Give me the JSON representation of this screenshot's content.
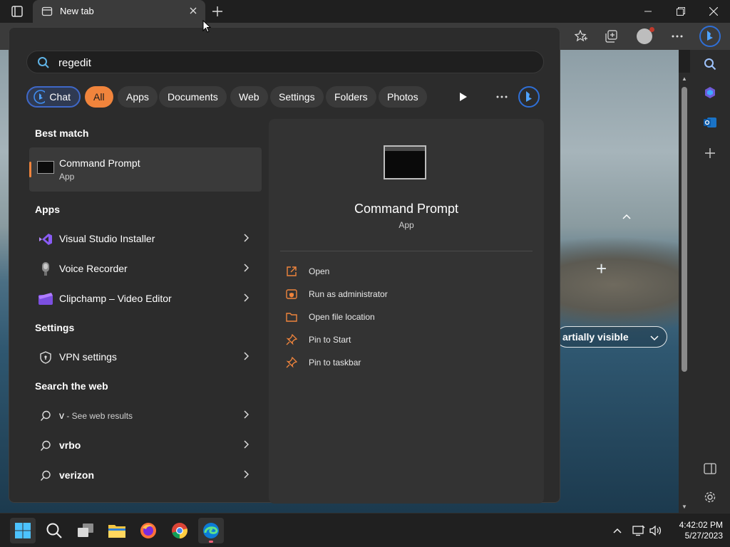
{
  "browser": {
    "tab_title": "New tab",
    "visibility_text": "artially visible"
  },
  "search": {
    "query": "regedit",
    "filters": [
      "Chat",
      "All",
      "Apps",
      "Documents",
      "Web",
      "Settings",
      "Folders",
      "Photos"
    ],
    "active_filter": "All"
  },
  "results": {
    "best_match_title": "Best match",
    "best_match": {
      "name": "Command Prompt",
      "type": "App"
    },
    "apps_title": "Apps",
    "apps": [
      "Visual Studio Installer",
      "Voice Recorder",
      "Clipchamp – Video Editor"
    ],
    "settings_title": "Settings",
    "settings": [
      "VPN settings"
    ],
    "web_title": "Search the web",
    "web": [
      {
        "query": "v",
        "suffix": " - See web results"
      },
      {
        "query": "vrbo",
        "suffix": ""
      },
      {
        "query": "verizon",
        "suffix": ""
      }
    ]
  },
  "preview": {
    "name": "Command Prompt",
    "type": "App",
    "actions": [
      "Open",
      "Run as administrator",
      "Open file location",
      "Pin to Start",
      "Pin to taskbar"
    ]
  },
  "taskbar": {
    "time": "4:42:02 PM",
    "date": "5/27/2023"
  },
  "colors": {
    "accent": "#f0843c",
    "chat_border": "#3f68c8",
    "panel": "#2c2c2c"
  },
  "icons": [
    "tab-actions-icon",
    "new-tab-icon",
    "minimize-icon",
    "restore-icon",
    "close-icon",
    "favorites-icon",
    "collections-icon",
    "profile-avatar",
    "more-icon",
    "copilot-icon",
    "search-icon",
    "play-icon",
    "windows-start-icon",
    "task-view-icon",
    "file-explorer-icon",
    "firefox-icon",
    "chrome-icon",
    "edge-icon",
    "network-icon",
    "volume-icon"
  ]
}
